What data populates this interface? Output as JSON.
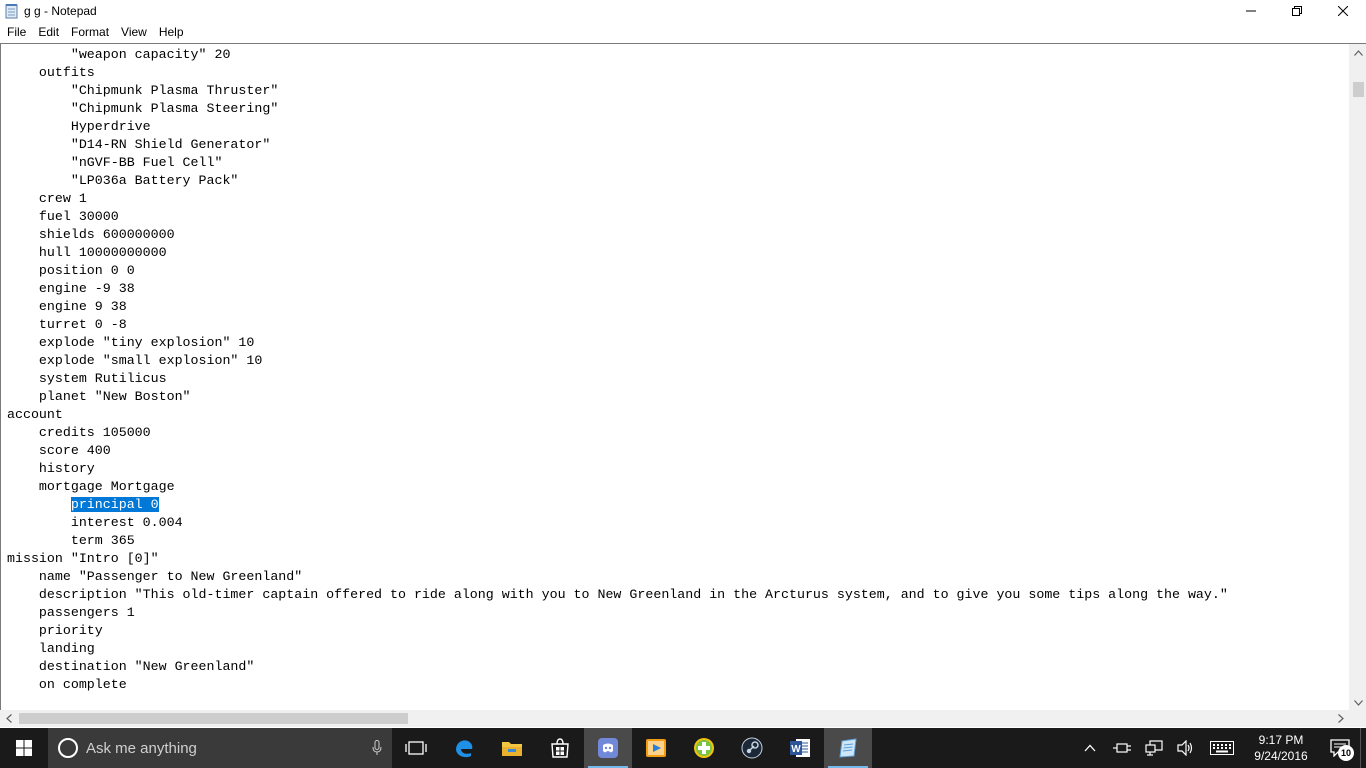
{
  "window": {
    "title": "g g - Notepad",
    "icon": "notepad-icon"
  },
  "menu": {
    "items": [
      "File",
      "Edit",
      "Format",
      "View",
      "Help"
    ]
  },
  "editor": {
    "lines": [
      "        \"weapon capacity\" 20",
      "    outfits",
      "        \"Chipmunk Plasma Thruster\"",
      "        \"Chipmunk Plasma Steering\"",
      "        Hyperdrive",
      "        \"D14-RN Shield Generator\"",
      "        \"nGVF-BB Fuel Cell\"",
      "        \"LP036a Battery Pack\"",
      "    crew 1",
      "    fuel 30000",
      "    shields 600000000",
      "    hull 10000000000",
      "    position 0 0",
      "    engine -9 38",
      "    engine 9 38",
      "    turret 0 -8",
      "    explode \"tiny explosion\" 10",
      "    explode \"small explosion\" 10",
      "    system Rutilicus",
      "    planet \"New Boston\"",
      "account",
      "    credits 105000",
      "    score 400",
      "    history",
      "    mortgage Mortgage",
      "        principal 0",
      "        interest 0.004",
      "        term 365",
      "mission \"Intro [0]\"",
      "    name \"Passenger to New Greenland\"",
      "    description \"This old-timer captain offered to ride along with you to New Greenland in the Arcturus system, and to give you some tips along the way.\"",
      "    passengers 1",
      "    priority",
      "    landing",
      "    destination \"New Greenland\"",
      "    on complete"
    ],
    "selected_line_index": 25,
    "selected_text": "principal 0",
    "selection_color": "#0078d7"
  },
  "taskbar": {
    "search_placeholder": "Ask me anything",
    "apps": [
      "task-view-icon",
      "edge-icon",
      "file-explorer-icon",
      "store-icon",
      "discord-icon",
      "media-player-icon",
      "plus-app-icon",
      "steam-icon",
      "word-icon",
      "notepad-icon"
    ],
    "clock_time": "9:17 PM",
    "clock_date": "9/24/2016",
    "notification_count": "10"
  }
}
